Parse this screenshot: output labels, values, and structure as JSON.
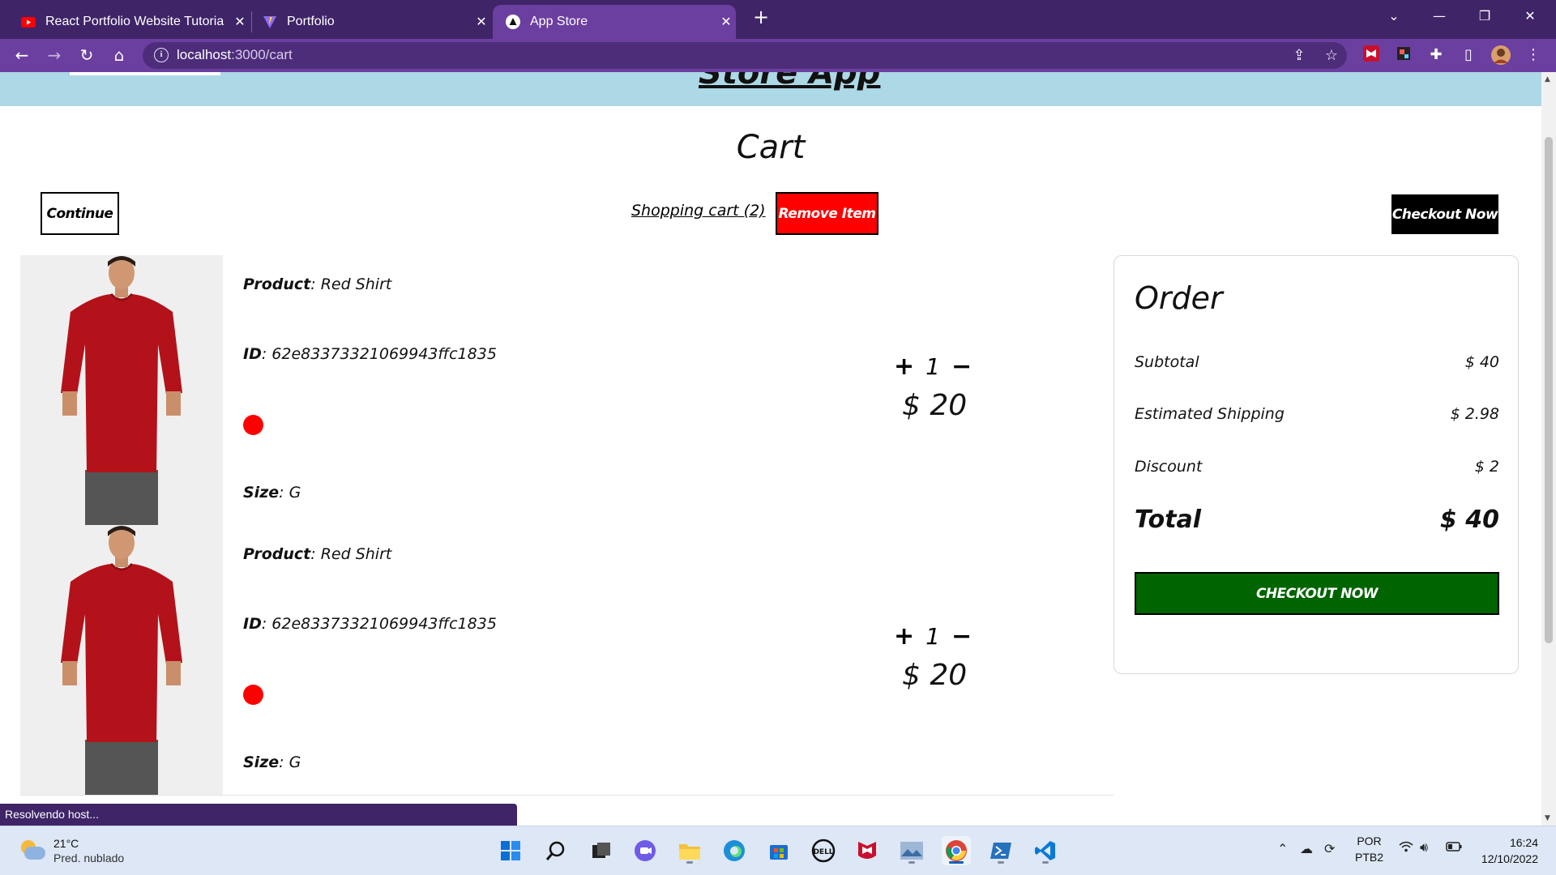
{
  "browser": {
    "tabs": [
      {
        "title": "React Portfolio Website Tutorial |",
        "favicon": "youtube-icon",
        "active": false
      },
      {
        "title": "Portfolio",
        "favicon": "vite-icon",
        "active": false
      },
      {
        "title": "App Store",
        "favicon": "app-store-icon",
        "active": true
      }
    ],
    "tab_close_glyph": "✕",
    "new_tab_glyph": "+",
    "url_host": "localhost",
    "url_path": ":3000/cart",
    "accent": "#6b3fa0",
    "tabbar_color": "#3f2467"
  },
  "site": {
    "logo": "Store App",
    "header_color": "#add8e6"
  },
  "cart": {
    "title": "Cart",
    "continue_label": "Continue",
    "shopping_cart_label": "Shopping cart (2)",
    "remove_label": "Remove Item",
    "checkout_label": "Checkout Now",
    "items": [
      {
        "product_label": "Product",
        "product": "Red Shirt",
        "id_label": "ID",
        "id": "62e83373321069943ffc1835",
        "color": "#ff0000",
        "size_label": "Size",
        "size": "G",
        "quantity": "1",
        "plus": "+",
        "minus": "−",
        "price": "$ 20"
      },
      {
        "product_label": "Product",
        "product": "Red Shirt",
        "id_label": "ID",
        "id": "62e83373321069943ffc1835",
        "color": "#ff0000",
        "size_label": "Size",
        "size": "G",
        "quantity": "1",
        "plus": "+",
        "minus": "−",
        "price": "$ 20"
      }
    ]
  },
  "order": {
    "title": "Order",
    "subtotal_label": "Subtotal",
    "subtotal": "$ 40",
    "shipping_label": "Estimated Shipping",
    "shipping": "$ 2.98",
    "discount_label": "Discount",
    "discount": "$ 2",
    "total_label": "Total",
    "total": "$ 40",
    "checkout_label": "CHECKOUT NOW",
    "checkout_color": "#006400"
  },
  "status_bar": "Resolvendo host...",
  "taskbar": {
    "temperature": "21°C",
    "weather": "Pred. nublado",
    "language": "POR",
    "keyboard": "PTB2",
    "time": "16:24",
    "date": "12/10/2022"
  }
}
